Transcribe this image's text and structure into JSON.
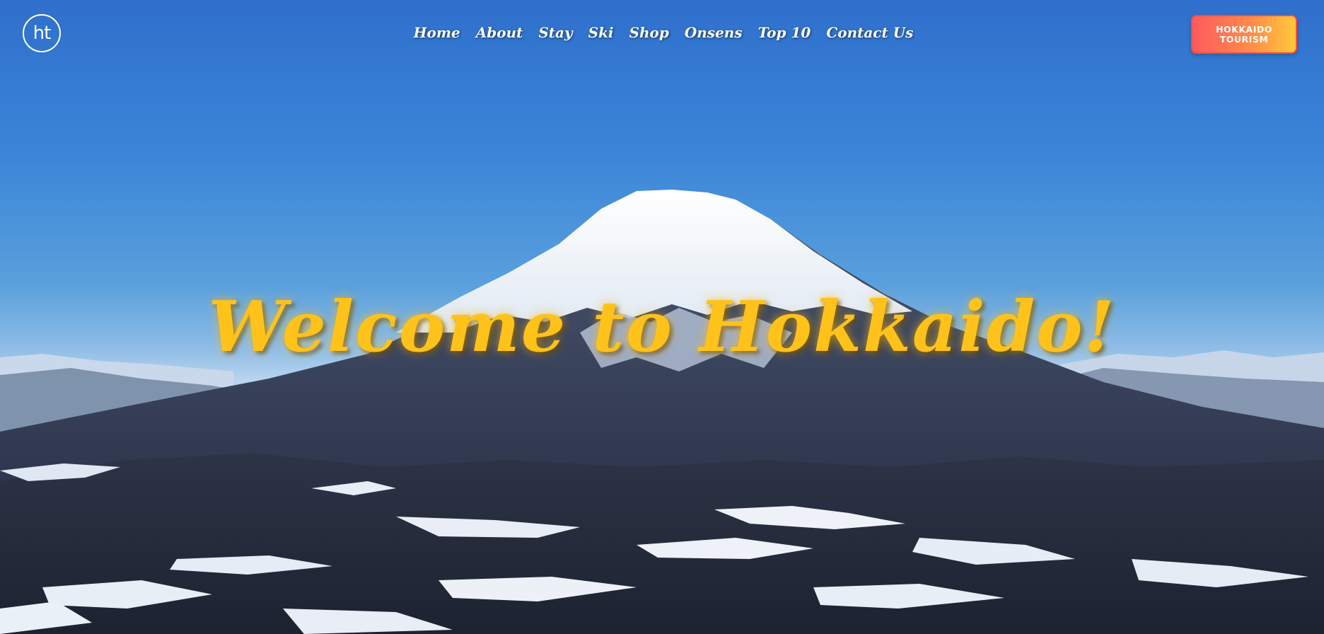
{
  "logo": {
    "text": "ht",
    "icon": "ht-logo-icon"
  },
  "nav": {
    "items": [
      "Home",
      "About",
      "Stay",
      "Ski",
      "Shop",
      "Onsens",
      "Top 10",
      "Contact Us"
    ]
  },
  "cta": {
    "label": "HOKKAIDO TOURISM"
  },
  "hero": {
    "headline": "Welcome to Hokkaido!"
  },
  "colors": {
    "headline": "#ffc21a",
    "cta_start": "#ff5a5f",
    "cta_end": "#ffc83a",
    "sky_top": "#2f6fcc"
  }
}
